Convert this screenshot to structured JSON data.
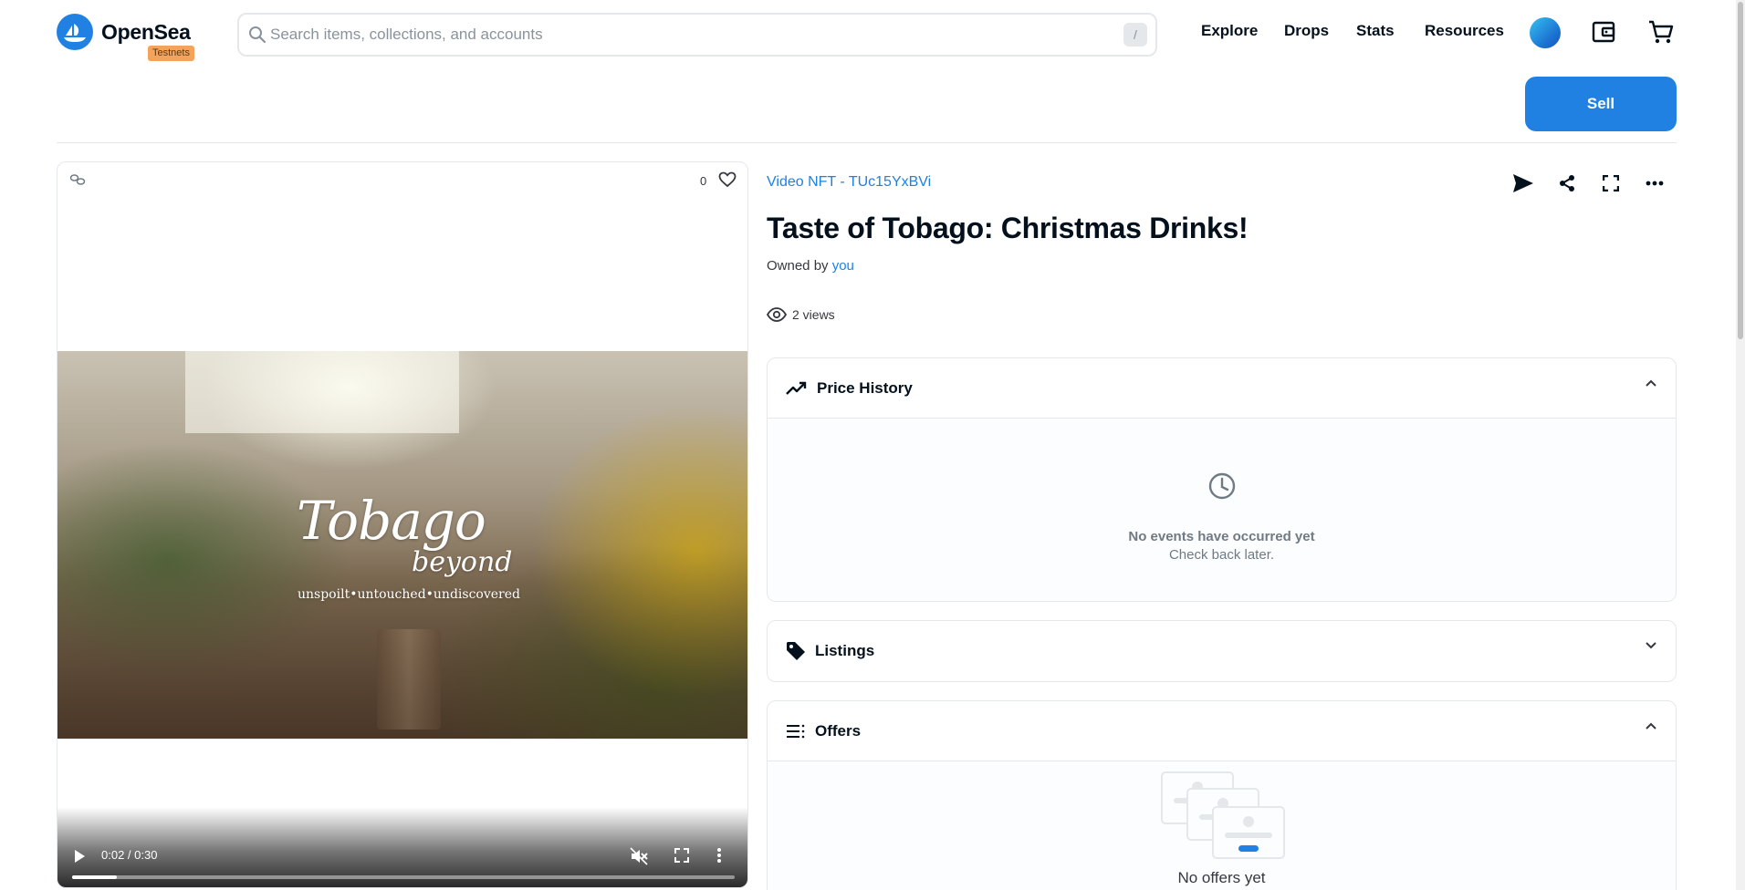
{
  "header": {
    "brand": "OpenSea",
    "badge": "Testnets",
    "search": {
      "placeholder": "Search items, collections, and accounts",
      "shortcut": "/"
    },
    "nav": [
      "Explore",
      "Drops",
      "Stats",
      "Resources"
    ],
    "icons": [
      "profile-avatar",
      "wallet-icon",
      "cart-icon"
    ],
    "sell_label": "Sell",
    "accent": "#2081e2"
  },
  "media": {
    "favorite_count": "0",
    "video": {
      "title_main": "Tobago",
      "title_sub": "beyond",
      "tagline": "unspoilt•untouched•undiscovered",
      "time": "0:02 / 0:30",
      "progress": 0.067
    }
  },
  "item": {
    "collection": "Video NFT - TUc15YxBVi",
    "title": "Taste of Tobago: Christmas Drinks!",
    "owned_prefix": "Owned by",
    "owner": "you",
    "views": "2 views",
    "actions": [
      "transfer-icon",
      "share-icon",
      "fullscreen-icon",
      "more-icon"
    ]
  },
  "price_history": {
    "label": "Price History",
    "empty_title": "No events have occurred yet",
    "empty_sub": "Check back later."
  },
  "listings": {
    "label": "Listings"
  },
  "offers": {
    "label": "Offers",
    "empty_title": "No offers yet"
  }
}
